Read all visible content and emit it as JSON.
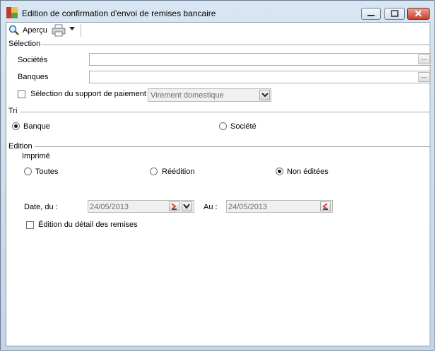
{
  "window": {
    "title": "Edition de confirmation d'envoi de remises bancaire"
  },
  "toolbar": {
    "preview_label": "Aperçu",
    "preview_icon": "magnifier-icon",
    "print_icon": "printer-icon"
  },
  "selection": {
    "section_label": "Sélection",
    "societes_label": "Sociétés",
    "societes_value": "",
    "banques_label": "Banques",
    "banques_value": "",
    "support_checkbox_label": "Sélection du support de paiement",
    "support_checked": false,
    "support_value": "Virement domestique"
  },
  "tri": {
    "section_label": "Tri",
    "options": [
      {
        "label": "Banque",
        "selected": true
      },
      {
        "label": "Société",
        "selected": false
      }
    ]
  },
  "edition": {
    "section_label": "Edition",
    "imprime_label": "Imprimé",
    "options": [
      {
        "label": "Toutes",
        "selected": false
      },
      {
        "label": "Réédition",
        "selected": false
      },
      {
        "label": "Non éditées",
        "selected": true
      }
    ],
    "date_from_label": "Date, du :",
    "date_from_value": "24/05/2013",
    "date_to_label": "Au :",
    "date_to_value": "24/05/2013",
    "detail_checkbox_label": "Édition du détail des remises",
    "detail_checked": false
  },
  "colors": {
    "titlebar": "#c3d6e8",
    "close_button": "#c8422c",
    "disabled_field": "#f0f0f0",
    "calendar_arrow": "#d9472b"
  }
}
